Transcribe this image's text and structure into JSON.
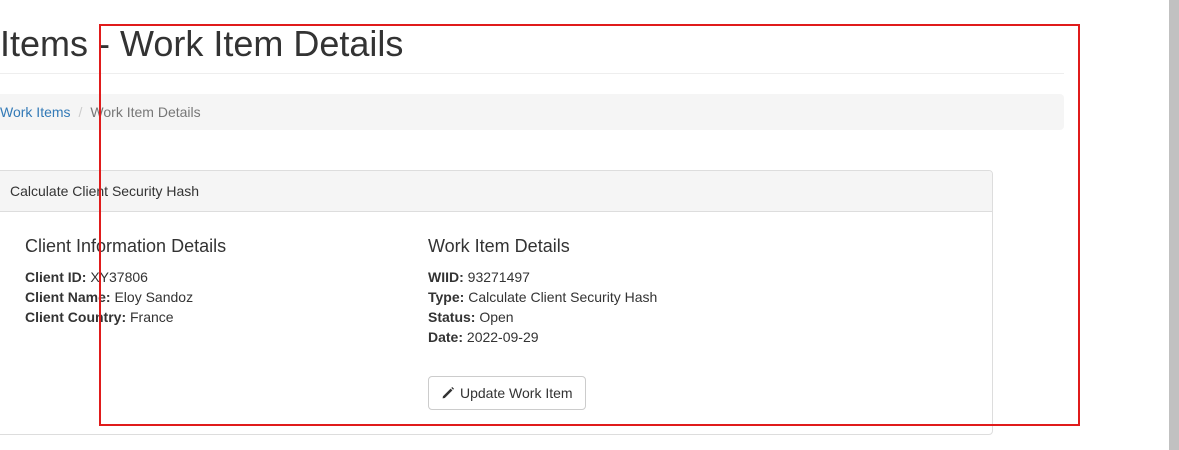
{
  "page": {
    "title": "k Items - Work Item Details"
  },
  "breadcrumb": {
    "link_label": "Work Items",
    "separator": "/",
    "current_label": "Work Item Details"
  },
  "panel": {
    "heading": "Calculate Client Security Hash",
    "client": {
      "heading": "Client Information Details",
      "id_label": "Client ID:",
      "id_value": "XY37806",
      "name_label": "Client Name:",
      "name_value": "Eloy Sandoz",
      "country_label": "Client Country:",
      "country_value": "France"
    },
    "work_item": {
      "heading": "Work Item Details",
      "wiid_label": "WIID:",
      "wiid_value": "93271497",
      "type_label": "Type:",
      "type_value": "Calculate Client Security Hash",
      "status_label": "Status:",
      "status_value": "Open",
      "date_label": "Date:",
      "date_value": "2022-09-29"
    },
    "update_button": {
      "label": "Update Work Item",
      "icon": "pencil-icon"
    }
  },
  "colors": {
    "link": "#337ab7",
    "highlight": "#e01b1b",
    "panel_heading_bg": "#f5f5f5"
  }
}
